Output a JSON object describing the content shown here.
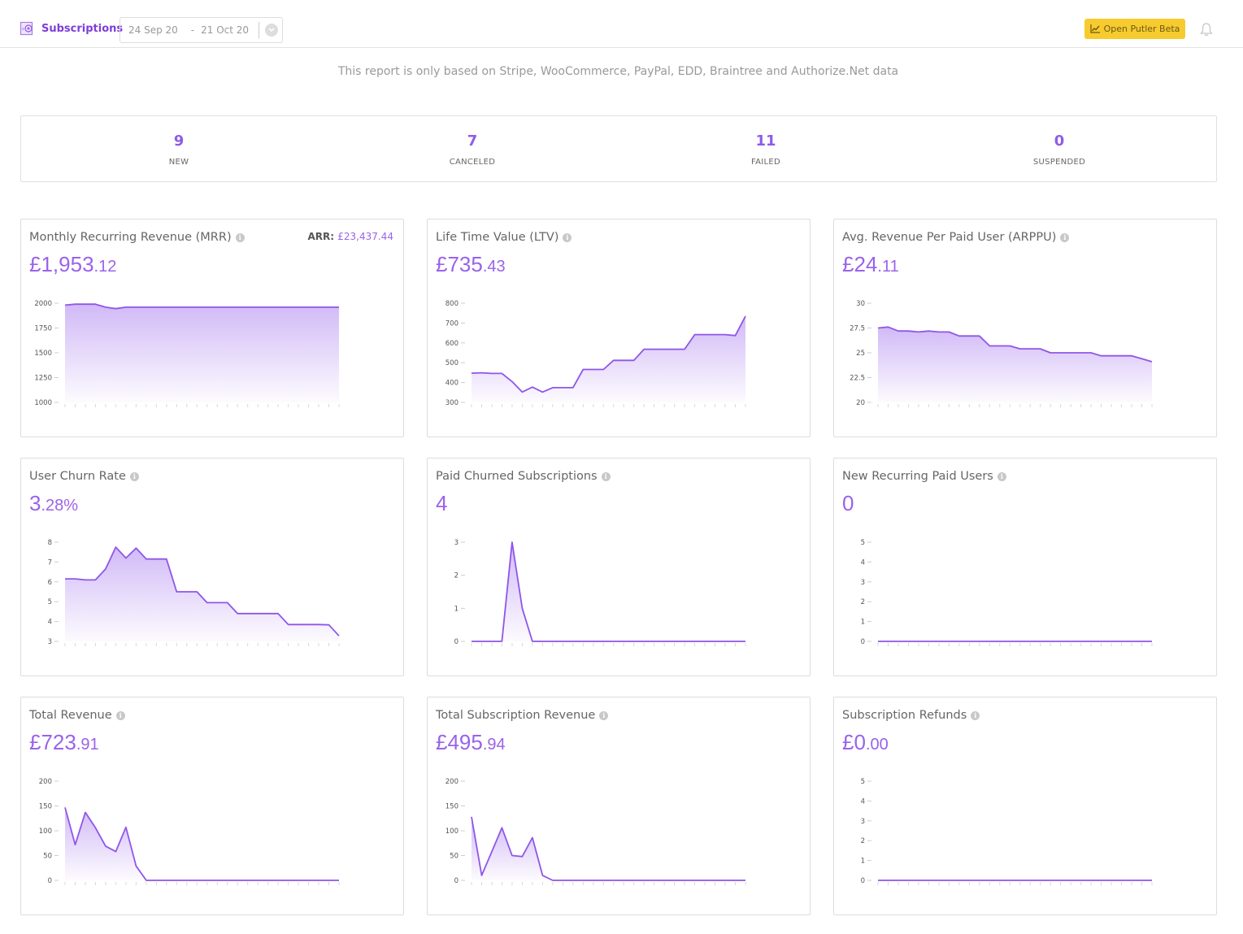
{
  "header": {
    "brand_label": "Subscriptions",
    "brand_icon": "subscriptions-icon",
    "date_from": "24 Sep 20",
    "date_separator": "-",
    "date_to": "21 Oct 20",
    "beta_button": "Open Putler Beta",
    "notification_icon": "bell-icon"
  },
  "notice": "This report is only based on Stripe, WooCommerce, PayPal, EDD, Braintree and Authorize.Net data",
  "stats": [
    {
      "value": "9",
      "label": "NEW"
    },
    {
      "value": "7",
      "label": "CANCELED"
    },
    {
      "value": "11",
      "label": "FAILED"
    },
    {
      "value": "0",
      "label": "SUSPENDED"
    }
  ],
  "colors": {
    "accent": "#9b62ea",
    "line": "#8f56e8",
    "beta": "#f7cb2e"
  },
  "cards": [
    {
      "title": "Monthly Recurring Revenue (MRR)",
      "main": "£1,953",
      "cents": ".12",
      "arr_label": "ARR:",
      "arr_value": "£23,437.44"
    },
    {
      "title": "Life Time Value (LTV)",
      "main": "£735",
      "cents": ".43"
    },
    {
      "title": "Avg. Revenue Per Paid User (ARPPU)",
      "main": "£24",
      "cents": ".11"
    },
    {
      "title": "User Churn Rate",
      "main": "3",
      "cents": ".28%"
    },
    {
      "title": "Paid Churned Subscriptions",
      "main": "4",
      "cents": ""
    },
    {
      "title": "New Recurring Paid Users",
      "main": "0",
      "cents": ""
    },
    {
      "title": "Total Revenue",
      "main": "£723",
      "cents": ".91"
    },
    {
      "title": "Total Subscription Revenue",
      "main": "£495",
      "cents": ".94"
    },
    {
      "title": "Subscription Refunds",
      "main": "£0",
      "cents": ".00"
    }
  ],
  "chart_data": [
    {
      "type": "area",
      "title": "Monthly Recurring Revenue (MRR)",
      "ylim": [
        1000,
        2000
      ],
      "yticks": [
        "1000",
        "1250",
        "1500",
        "1750",
        "2000"
      ],
      "values": [
        1980,
        1990,
        1990,
        1990,
        1960,
        1945,
        1960,
        1960,
        1960,
        1960,
        1960,
        1960,
        1960,
        1960,
        1960,
        1960,
        1960,
        1960,
        1960,
        1960,
        1960,
        1960,
        1960,
        1960,
        1960,
        1960,
        1960,
        1960
      ]
    },
    {
      "type": "area",
      "title": "Life Time Value (LTV)",
      "ylim": [
        300,
        800
      ],
      "yticks": [
        "300",
        "400",
        "500",
        "600",
        "700",
        "800"
      ],
      "values": [
        447,
        449,
        446,
        446,
        405,
        352,
        377,
        352,
        374,
        374,
        374,
        466,
        466,
        466,
        512,
        512,
        512,
        568,
        568,
        568,
        568,
        568,
        642,
        642,
        642,
        642,
        637,
        735
      ]
    },
    {
      "type": "area",
      "title": "Avg. Revenue Per Paid User (ARPPU)",
      "ylim": [
        20,
        30
      ],
      "yticks": [
        "20",
        "22.5",
        "25",
        "27.5",
        "30"
      ],
      "values": [
        27.5,
        27.6,
        27.2,
        27.2,
        27.1,
        27.2,
        27.1,
        27.1,
        26.7,
        26.7,
        26.7,
        25.7,
        25.7,
        25.7,
        25.4,
        25.4,
        25.4,
        25.0,
        25.0,
        25.0,
        25.0,
        25.0,
        24.7,
        24.7,
        24.7,
        24.7,
        24.4,
        24.1
      ]
    },
    {
      "type": "area",
      "title": "User Churn Rate",
      "ylim": [
        3,
        8
      ],
      "yticks": [
        "3",
        "4",
        "5",
        "6",
        "7",
        "8"
      ],
      "values": [
        6.15,
        6.15,
        6.1,
        6.1,
        6.65,
        7.75,
        7.2,
        7.7,
        7.15,
        7.15,
        7.15,
        5.5,
        5.5,
        5.5,
        4.95,
        4.95,
        4.95,
        4.4,
        4.4,
        4.4,
        4.4,
        4.4,
        3.85,
        3.85,
        3.85,
        3.85,
        3.83,
        3.28
      ]
    },
    {
      "type": "area",
      "title": "Paid Churned Subscriptions",
      "ylim": [
        0,
        3
      ],
      "yticks": [
        "0",
        "1",
        "2",
        "3"
      ],
      "values": [
        0,
        0,
        0,
        0,
        3,
        1,
        0,
        0,
        0,
        0,
        0,
        0,
        0,
        0,
        0,
        0,
        0,
        0,
        0,
        0,
        0,
        0,
        0,
        0,
        0,
        0,
        0,
        0
      ]
    },
    {
      "type": "area",
      "title": "New Recurring Paid Users",
      "ylim": [
        0,
        5
      ],
      "yticks": [
        "0",
        "1",
        "2",
        "3",
        "4",
        "5"
      ],
      "values": [
        0,
        0,
        0,
        0,
        0,
        0,
        0,
        0,
        0,
        0,
        0,
        0,
        0,
        0,
        0,
        0,
        0,
        0,
        0,
        0,
        0,
        0,
        0,
        0,
        0,
        0,
        0,
        0
      ]
    },
    {
      "type": "area",
      "title": "Total Revenue",
      "ylim": [
        0,
        200
      ],
      "yticks": [
        "0",
        "50",
        "100",
        "150",
        "200"
      ],
      "values": [
        147,
        72,
        137,
        106,
        69,
        58,
        107,
        29,
        0,
        0,
        0,
        0,
        0,
        0,
        0,
        0,
        0,
        0,
        0,
        0,
        0,
        0,
        0,
        0,
        0,
        0,
        0,
        0
      ]
    },
    {
      "type": "area",
      "title": "Total Subscription Revenue",
      "ylim": [
        0,
        200
      ],
      "yticks": [
        "0",
        "50",
        "100",
        "150",
        "200"
      ],
      "values": [
        128,
        10,
        58,
        106,
        50,
        48,
        86,
        10,
        0,
        0,
        0,
        0,
        0,
        0,
        0,
        0,
        0,
        0,
        0,
        0,
        0,
        0,
        0,
        0,
        0,
        0,
        0,
        0
      ]
    },
    {
      "type": "area",
      "title": "Subscription Refunds",
      "ylim": [
        0,
        5
      ],
      "yticks": [
        "0",
        "1",
        "2",
        "3",
        "4",
        "5"
      ],
      "values": [
        0,
        0,
        0,
        0,
        0,
        0,
        0,
        0,
        0,
        0,
        0,
        0,
        0,
        0,
        0,
        0,
        0,
        0,
        0,
        0,
        0,
        0,
        0,
        0,
        0,
        0,
        0,
        0
      ]
    }
  ]
}
